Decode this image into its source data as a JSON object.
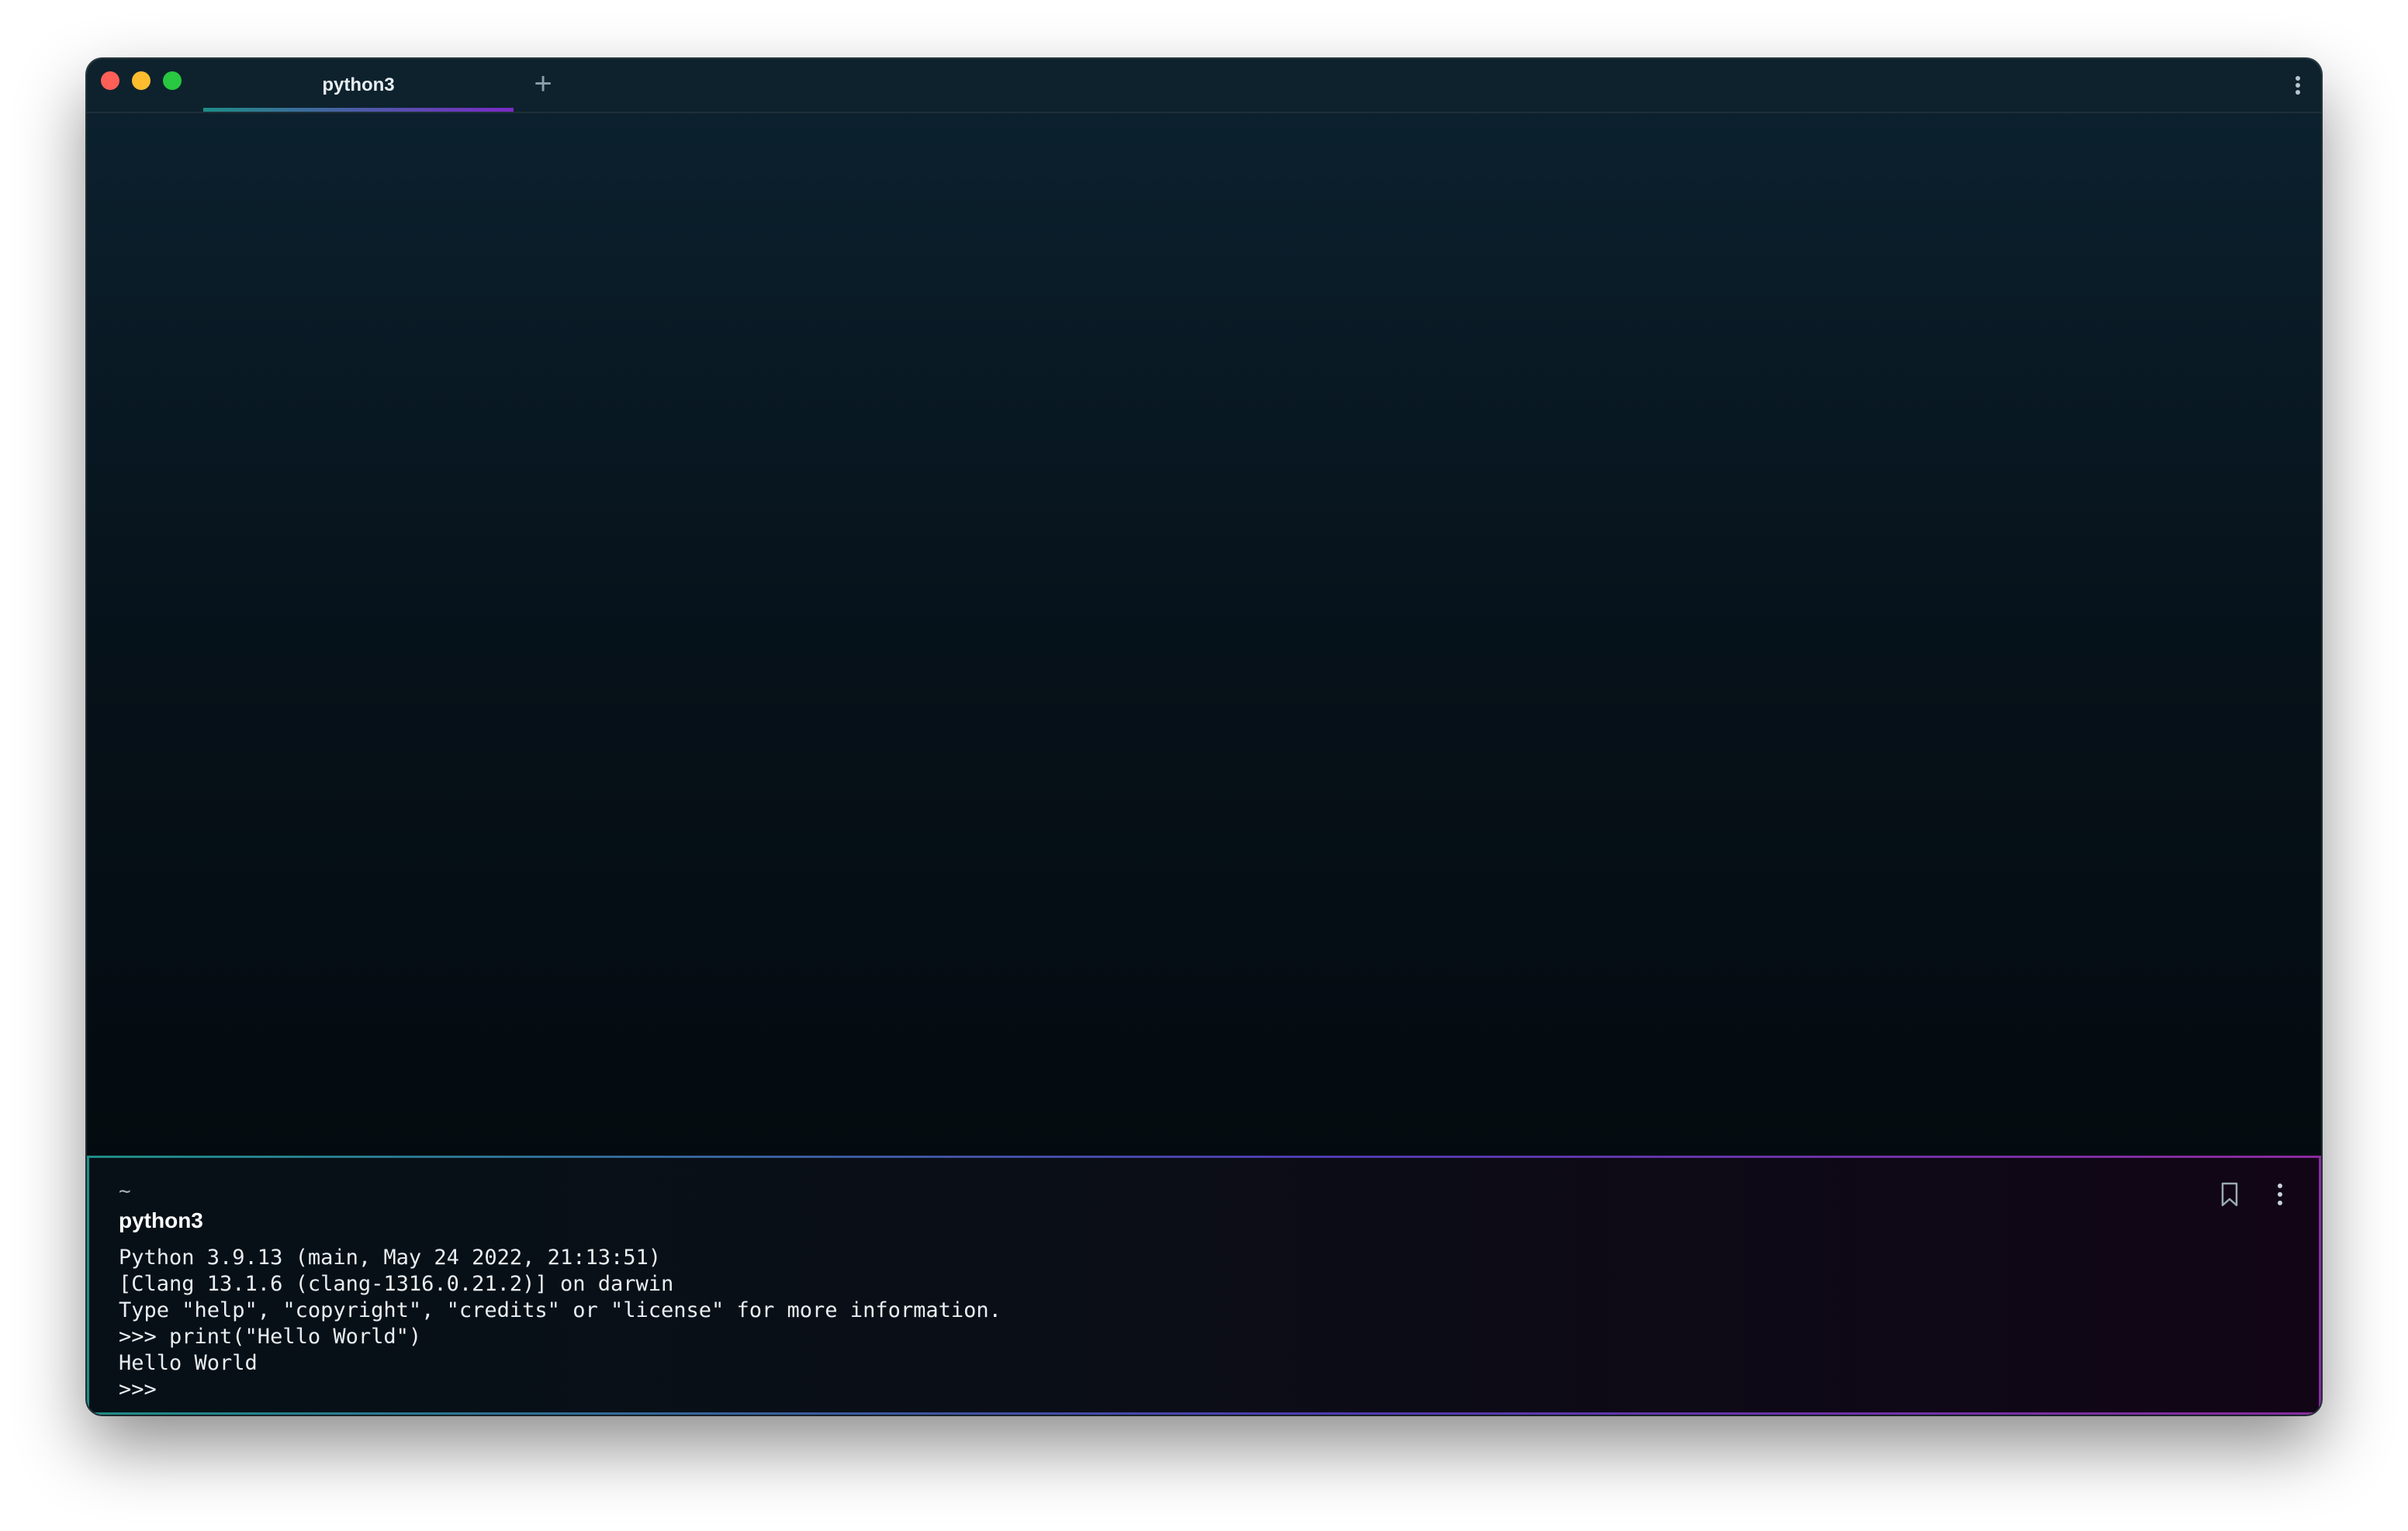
{
  "window": {
    "traffic_lights": [
      "close",
      "minimize",
      "maximize"
    ],
    "tab": {
      "label": "python3"
    },
    "new_tab_label": "+"
  },
  "block": {
    "cwd": "~",
    "command": "python3",
    "output_lines": [
      "Python 3.9.13 (main, May 24 2022, 21:13:51)",
      "[Clang 13.1.6 (clang-1316.0.21.2)] on darwin",
      "Type \"help\", \"copyright\", \"credits\" or \"license\" for more information.",
      ">>> print(\"Hello World\")",
      "Hello World",
      ">>>"
    ],
    "icons": [
      "bookmark-icon",
      "more-icon"
    ]
  },
  "colors": {
    "accent_teal": "#1e8d86",
    "accent_purple": "#7a2ac6",
    "close": "#fe5f57",
    "minimize": "#febc2e",
    "maximize": "#28c840"
  }
}
